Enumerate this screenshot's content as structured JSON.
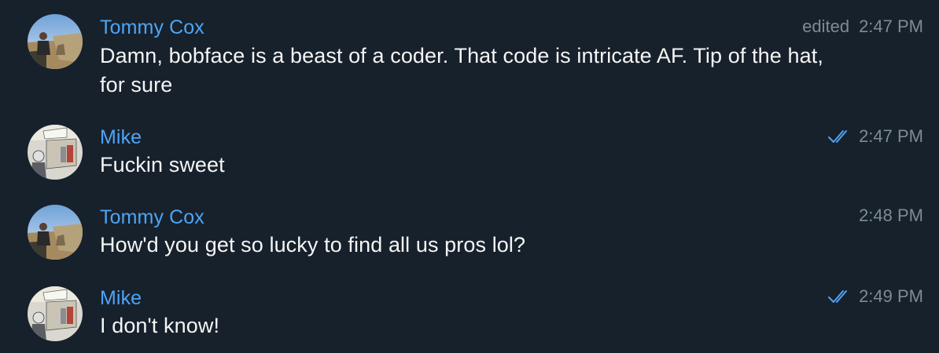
{
  "messages": [
    {
      "sender": "Tommy Cox",
      "sender_color": "#4ea4f6",
      "text": "Damn, bobface is a beast of a coder. That code is intricate AF. Tip of the hat, for sure",
      "edited": "edited",
      "time": "2:47 PM",
      "status_icon": ""
    },
    {
      "sender": "Mike",
      "sender_color": "#4ea4f6",
      "text": "Fuckin sweet",
      "time": "2:47 PM",
      "status_icon": "double-check-icon"
    },
    {
      "sender": "Tommy Cox",
      "sender_color": "#4ea4f6",
      "text": "How'd you get so lucky to find all us pros lol?",
      "time": "2:48 PM",
      "status_icon": ""
    },
    {
      "sender": "Mike",
      "sender_color": "#4ea4f6",
      "text": "I don't know!",
      "time": "2:49 PM",
      "status_icon": "double-check-icon"
    }
  ],
  "colors": {
    "background": "#17212b",
    "accent": "#4ea4f6",
    "meta": "#7e8a96",
    "text": "#f5f5f5"
  }
}
